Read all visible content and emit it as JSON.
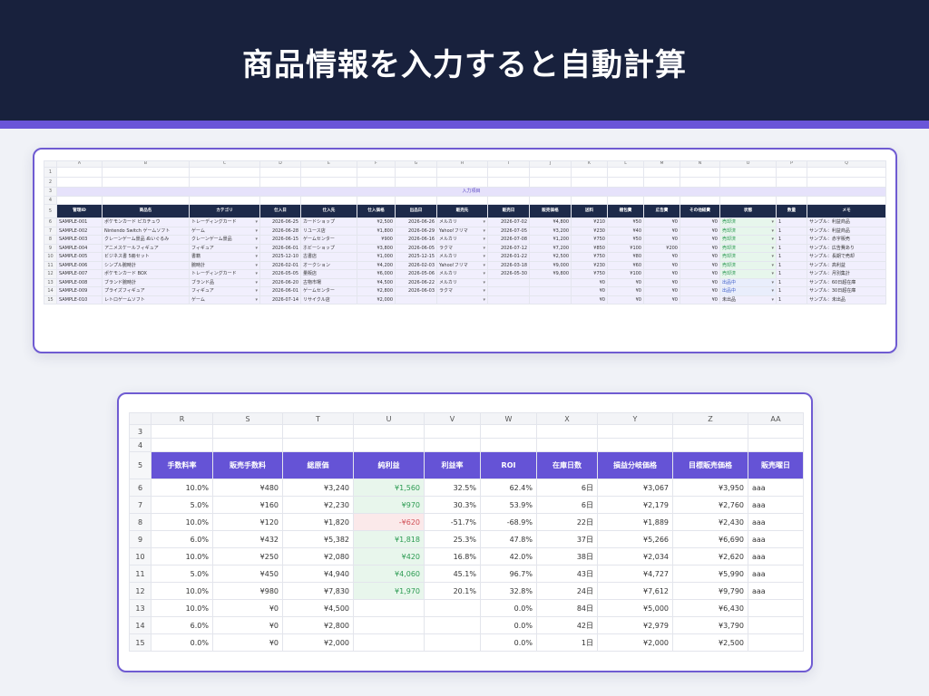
{
  "title": "商品情報を入力すると自動計算",
  "colors": {
    "banner": "#18213d",
    "accent": "#6a55d8",
    "header_dark": "#1d2a4a",
    "header_purple": "#6553d6",
    "positive": "#2c9b52",
    "negative": "#d04e55"
  },
  "sheet1": {
    "col_letters": [
      "A",
      "B",
      "C",
      "D",
      "E",
      "F",
      "G",
      "H",
      "I",
      "J",
      "K",
      "L",
      "M",
      "N",
      "O",
      "P",
      "Q"
    ],
    "blank_rows": [
      "1",
      "2"
    ],
    "section_row": {
      "num": "3",
      "label": "入力項目"
    },
    "row4": "4",
    "header_row": {
      "num": "5",
      "cells": [
        "管理ID",
        "商品名",
        "カテゴリ",
        "仕入日",
        "仕入先",
        "仕入価格",
        "出品日",
        "販売先",
        "販売日",
        "販売価格",
        "送料",
        "梱包費",
        "広告費",
        "その他経費",
        "状態",
        "数量",
        "メモ"
      ]
    },
    "rows": [
      {
        "num": "6",
        "cells": [
          "SAMPLE-001",
          "ポケモンカード ピカチュウ",
          "トレーディングカード",
          "2026-06-25",
          "カードショップ",
          "¥2,500",
          "2026-06-26",
          "メルカリ",
          "2026-07-02",
          "¥4,800",
          "¥210",
          "¥50",
          "¥0",
          "¥0",
          "売却済",
          "1",
          "サンプル：利益商品"
        ],
        "status": "g"
      },
      {
        "num": "7",
        "cells": [
          "SAMPLE-002",
          "Nintendo Switch ゲームソフト",
          "ゲーム",
          "2026-06-28",
          "リユース店",
          "¥1,800",
          "2026-06-29",
          "Yahoo!フリマ",
          "2026-07-05",
          "¥3,200",
          "¥230",
          "¥40",
          "¥0",
          "¥0",
          "売却済",
          "1",
          "サンプル：利益商品"
        ],
        "status": "g"
      },
      {
        "num": "8",
        "cells": [
          "SAMPLE-003",
          "クレーンゲーム景品 ぬいぐるみ",
          "クレーンゲーム景品",
          "2026-06-15",
          "ゲームセンター",
          "¥900",
          "2026-06-16",
          "メルカリ",
          "2026-07-08",
          "¥1,200",
          "¥750",
          "¥50",
          "¥0",
          "¥0",
          "売却済",
          "1",
          "サンプル：赤字販売"
        ],
        "status": "g"
      },
      {
        "num": "9",
        "cells": [
          "SAMPLE-004",
          "アニメスケールフィギュア",
          "フィギュア",
          "2026-06-01",
          "ホビーショップ",
          "¥3,800",
          "2026-06-05",
          "ラクマ",
          "2026-07-12",
          "¥7,200",
          "¥850",
          "¥100",
          "¥200",
          "¥0",
          "売却済",
          "1",
          "サンプル：広告費あり"
        ],
        "status": "g"
      },
      {
        "num": "10",
        "cells": [
          "SAMPLE-005",
          "ビジネス書 5冊セット",
          "書籍",
          "2025-12-10",
          "古書店",
          "¥1,000",
          "2025-12-15",
          "メルカリ",
          "2026-01-22",
          "¥2,500",
          "¥750",
          "¥80",
          "¥0",
          "¥0",
          "売却済",
          "1",
          "サンプル：長期で売却"
        ],
        "status": "g"
      },
      {
        "num": "11",
        "cells": [
          "SAMPLE-006",
          "シンプル腕時計",
          "腕時計",
          "2026-02-01",
          "オークション",
          "¥4,200",
          "2026-02-03",
          "Yahoo!フリマ",
          "2026-03-18",
          "¥9,000",
          "¥230",
          "¥60",
          "¥0",
          "¥0",
          "売却済",
          "1",
          "サンプル：高利益"
        ],
        "status": "g"
      },
      {
        "num": "12",
        "cells": [
          "SAMPLE-007",
          "ポケモンカード BOX",
          "トレーディングカード",
          "2026-05-05",
          "量販店",
          "¥6,000",
          "2026-05-06",
          "メルカリ",
          "2026-05-30",
          "¥9,800",
          "¥750",
          "¥100",
          "¥0",
          "¥0",
          "売却済",
          "1",
          "サンプル：月別集計"
        ],
        "status": "g"
      },
      {
        "num": "13",
        "cells": [
          "SAMPLE-008",
          "ブランド腕時計",
          "ブランド品",
          "2026-06-20",
          "古物市場",
          "¥4,500",
          "2026-06-22",
          "メルカリ",
          "",
          "",
          "¥0",
          "¥0",
          "¥0",
          "¥0",
          "出品中",
          "1",
          "サンプル：60日超在庫"
        ],
        "status": "b"
      },
      {
        "num": "14",
        "cells": [
          "SAMPLE-009",
          "プライズフィギュア",
          "フィギュア",
          "2026-06-01",
          "ゲームセンター",
          "¥2,800",
          "2026-06-03",
          "ラクマ",
          "",
          "",
          "¥0",
          "¥0",
          "¥0",
          "¥0",
          "出品中",
          "1",
          "サンプル：30日超在庫"
        ],
        "status": "b"
      },
      {
        "num": "15",
        "cells": [
          "SAMPLE-010",
          "レトロゲームソフト",
          "ゲーム",
          "2026-07-14",
          "リサイクル店",
          "¥2,000",
          "",
          "",
          "",
          "",
          "¥0",
          "¥0",
          "¥0",
          "¥0",
          "未出品",
          "1",
          "サンプル：未出品"
        ],
        "status": "n"
      }
    ]
  },
  "sheet2": {
    "col_letters": [
      "R",
      "S",
      "T",
      "U",
      "V",
      "W",
      "X",
      "Y",
      "Z",
      "AA"
    ],
    "blank_rows": [
      "3",
      "4"
    ],
    "header_row": {
      "num": "5",
      "cells": [
        "手数料率",
        "販売手数料",
        "総原価",
        "純利益",
        "利益率",
        "ROI",
        "在庫日数",
        "損益分岐価格",
        "目標販売価格",
        "販売曜日"
      ]
    },
    "rows": [
      {
        "num": "6",
        "cells": [
          "10.0%",
          "¥480",
          "¥3,240",
          "¥1,560",
          "32.5%",
          "62.4%",
          "6日",
          "¥3,067",
          "¥3,950",
          "aaa"
        ],
        "profit": "pos"
      },
      {
        "num": "7",
        "cells": [
          "5.0%",
          "¥160",
          "¥2,230",
          "¥970",
          "30.3%",
          "53.9%",
          "6日",
          "¥2,179",
          "¥2,760",
          "aaa"
        ],
        "profit": "pos"
      },
      {
        "num": "8",
        "cells": [
          "10.0%",
          "¥120",
          "¥1,820",
          "-¥620",
          "-51.7%",
          "-68.9%",
          "22日",
          "¥1,889",
          "¥2,430",
          "aaa"
        ],
        "profit": "neg"
      },
      {
        "num": "9",
        "cells": [
          "6.0%",
          "¥432",
          "¥5,382",
          "¥1,818",
          "25.3%",
          "47.8%",
          "37日",
          "¥5,266",
          "¥6,690",
          "aaa"
        ],
        "profit": "pos"
      },
      {
        "num": "10",
        "cells": [
          "10.0%",
          "¥250",
          "¥2,080",
          "¥420",
          "16.8%",
          "42.0%",
          "38日",
          "¥2,034",
          "¥2,620",
          "aaa"
        ],
        "profit": "pos"
      },
      {
        "num": "11",
        "cells": [
          "5.0%",
          "¥450",
          "¥4,940",
          "¥4,060",
          "45.1%",
          "96.7%",
          "43日",
          "¥4,727",
          "¥5,990",
          "aaa"
        ],
        "profit": "pos"
      },
      {
        "num": "12",
        "cells": [
          "10.0%",
          "¥980",
          "¥7,830",
          "¥1,970",
          "20.1%",
          "32.8%",
          "24日",
          "¥7,612",
          "¥9,790",
          "aaa"
        ],
        "profit": "pos"
      },
      {
        "num": "13",
        "cells": [
          "10.0%",
          "¥0",
          "¥4,500",
          "",
          "",
          "0.0%",
          "84日",
          "¥5,000",
          "¥6,430",
          ""
        ],
        "profit": "none"
      },
      {
        "num": "14",
        "cells": [
          "6.0%",
          "¥0",
          "¥2,800",
          "",
          "",
          "0.0%",
          "42日",
          "¥2,979",
          "¥3,790",
          ""
        ],
        "profit": "none"
      },
      {
        "num": "15",
        "cells": [
          "0.0%",
          "¥0",
          "¥2,000",
          "",
          "",
          "0.0%",
          "1日",
          "¥2,000",
          "¥2,500",
          ""
        ],
        "profit": "none"
      }
    ]
  }
}
